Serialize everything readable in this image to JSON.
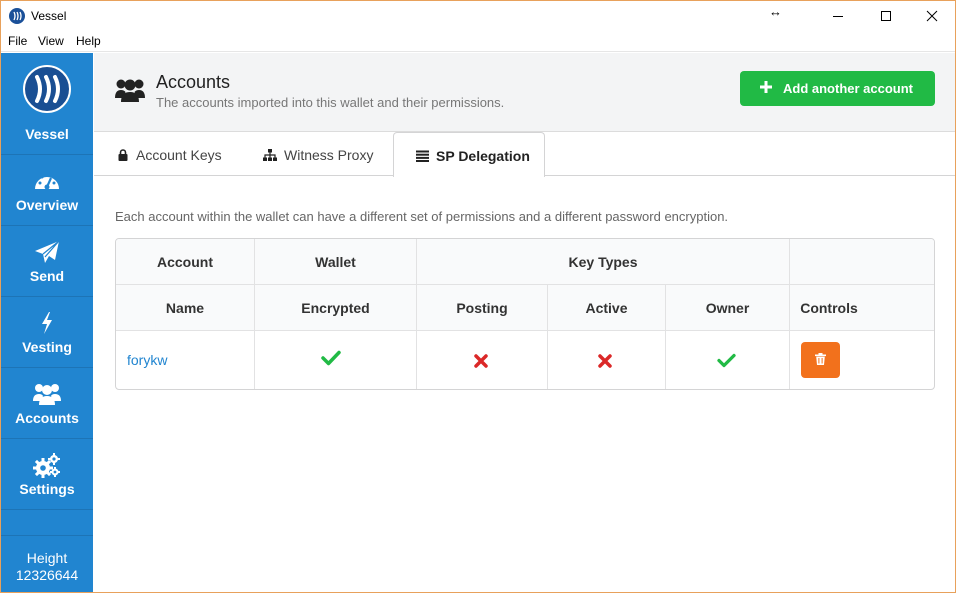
{
  "window": {
    "title": "Vessel",
    "resize_glyph": "↔"
  },
  "menu": {
    "file": "File",
    "view": "View",
    "help": "Help"
  },
  "sidebar": {
    "brand": "Vessel",
    "items": [
      {
        "label": "Overview",
        "icon": "dashboard-icon"
      },
      {
        "label": "Send",
        "icon": "paper-plane-icon"
      },
      {
        "label": "Vesting",
        "icon": "lightning-icon"
      },
      {
        "label": "Accounts",
        "icon": "users-icon"
      },
      {
        "label": "Settings",
        "icon": "gears-icon"
      }
    ],
    "height_label": "Height",
    "height_value": "12326644"
  },
  "header": {
    "title": "Accounts",
    "subtitle": "The accounts imported into this wallet and their permissions.",
    "add_button": "Add another account"
  },
  "tabs": [
    {
      "label": "Account Keys",
      "icon": "lock-icon",
      "active": false
    },
    {
      "label": "Witness Proxy",
      "icon": "sitemap-icon",
      "active": false
    },
    {
      "label": "SP Delegation",
      "icon": "list-icon",
      "active": true
    }
  ],
  "description": "Each account within the wallet can have a different set of permissions and a different password encryption.",
  "table": {
    "group_headers": {
      "account": "Account",
      "wallet": "Wallet",
      "key_types": "Key Types"
    },
    "columns": {
      "name": "Name",
      "encrypted": "Encrypted",
      "posting": "Posting",
      "active": "Active",
      "owner": "Owner",
      "controls": "Controls"
    },
    "rows": [
      {
        "name": "forykw",
        "encrypted": true,
        "posting": false,
        "active": false,
        "owner": true
      }
    ]
  },
  "colors": {
    "sidebar": "#2185d0",
    "add_button": "#21ba45",
    "delete_button": "#f2711c",
    "check": "#21ba45",
    "cross": "#db2828",
    "link": "#2185d0"
  }
}
